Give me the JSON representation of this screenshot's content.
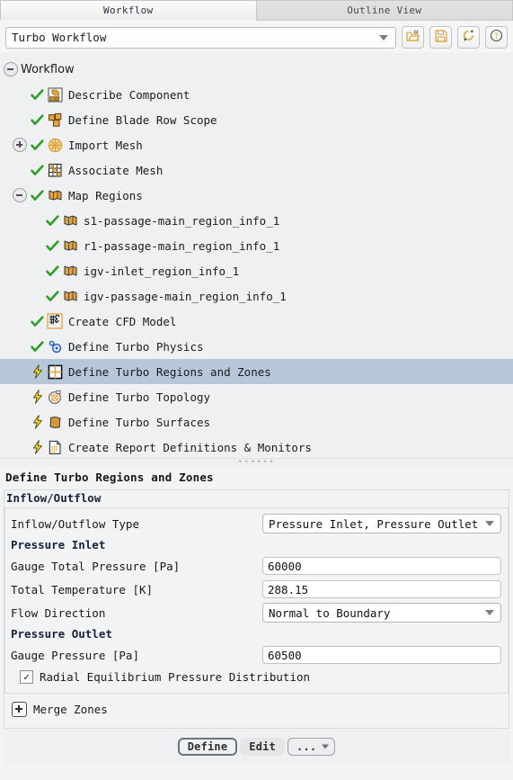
{
  "tabs": [
    {
      "label": "Workflow",
      "active": true
    },
    {
      "label": "Outline View",
      "active": false
    }
  ],
  "toolbar": {
    "workflow_name": "Turbo Workflow",
    "buttons": [
      {
        "name": "open-workflow-button",
        "icon": "folder-open-icon"
      },
      {
        "name": "save-workflow-button",
        "icon": "save-disk-icon"
      },
      {
        "name": "reset-workflow-button",
        "icon": "refresh-icon"
      },
      {
        "name": "help-button",
        "icon": "help-question-icon"
      }
    ]
  },
  "tree": {
    "root": {
      "label": "Workflow",
      "expander": "minus"
    },
    "items": [
      {
        "label": "Describe Component",
        "status": "check",
        "icon": "cad-box-icon",
        "indent": 1,
        "expander": "none"
      },
      {
        "label": "Define Blade Row Scope",
        "status": "check",
        "icon": "blade-row-icon",
        "indent": 1,
        "expander": "none"
      },
      {
        "label": "Import Mesh",
        "status": "check",
        "icon": "mesh-sphere-icon",
        "indent": 1,
        "expander": "plus"
      },
      {
        "label": "Associate Mesh",
        "status": "check",
        "icon": "grid-mesh-icon",
        "indent": 1,
        "expander": "none"
      },
      {
        "label": "Map Regions",
        "status": "check",
        "icon": "map-regions-icon",
        "indent": 1,
        "expander": "minus"
      },
      {
        "label": "s1-passage-main_region_info_1",
        "status": "check",
        "icon": "map-regions-icon",
        "indent": 2,
        "expander": "none"
      },
      {
        "label": "r1-passage-main_region_info_1",
        "status": "check",
        "icon": "map-regions-icon",
        "indent": 2,
        "expander": "none"
      },
      {
        "label": "igv-inlet_region_info_1",
        "status": "check",
        "icon": "map-regions-icon",
        "indent": 2,
        "expander": "none"
      },
      {
        "label": "igv-passage-main_region_info_1",
        "status": "check",
        "icon": "map-regions-icon",
        "indent": 2,
        "expander": "none"
      },
      {
        "label": "Create CFD Model",
        "status": "check",
        "icon": "cfd-model-icon",
        "indent": 1,
        "expander": "none"
      },
      {
        "label": "Define Turbo Physics",
        "status": "check",
        "icon": "turbo-physics-icon",
        "indent": 1,
        "expander": "none"
      },
      {
        "label": "Define Turbo Regions and Zones",
        "status": "bolt",
        "icon": "regions-zones-grid-icon",
        "indent": 1,
        "expander": "none",
        "selected": true
      },
      {
        "label": "Define Turbo Topology",
        "status": "bolt",
        "icon": "turbo-topology-icon",
        "indent": 1,
        "expander": "none"
      },
      {
        "label": "Define Turbo Surfaces",
        "status": "bolt",
        "icon": "turbo-surfaces-icon",
        "indent": 1,
        "expander": "none"
      },
      {
        "label": "Create Report Definitions & Monitors",
        "status": "bolt",
        "icon": "report-definitions-icon",
        "indent": 1,
        "expander": "none"
      }
    ]
  },
  "panel": {
    "title": "Define Turbo Regions and Zones",
    "group_title": "Inflow/Outflow",
    "rows": [
      {
        "label": "Inflow/Outflow Type",
        "type": "dropdown",
        "value": "Pressure Inlet, Pressure Outlet"
      },
      {
        "label": "Pressure Inlet",
        "type": "section"
      },
      {
        "label": "Gauge Total Pressure [Pa]",
        "type": "text",
        "value": "60000"
      },
      {
        "label": "Total Temperature [K]",
        "type": "text",
        "value": "288.15"
      },
      {
        "label": "Flow Direction",
        "type": "dropdown",
        "value": "Normal to Boundary"
      },
      {
        "label": "Pressure Outlet",
        "type": "section"
      },
      {
        "label": "Gauge Pressure [Pa]",
        "type": "text",
        "value": "60500"
      }
    ],
    "checkbox": {
      "label": "Radial Equilibrium Pressure Distribution",
      "checked": true,
      "mark": "✓"
    },
    "merge_zones": {
      "label": "Merge Zones",
      "expander": "plus"
    }
  },
  "footer": {
    "buttons": [
      {
        "label": "Define",
        "style": "primary",
        "name": "define-button"
      },
      {
        "label": "Edit",
        "style": "flat",
        "name": "edit-button"
      },
      {
        "label": "...",
        "style": "menu",
        "name": "more-options-button"
      }
    ]
  },
  "colors": {
    "accent_orange": "#e8a33d",
    "check_green": "#2f9e28",
    "bolt_yellow": "#f2d32a",
    "selection_blue": "#b6c7d9",
    "panel_bg": "#f2f3f4",
    "tree_bg": "#eef0f2"
  }
}
